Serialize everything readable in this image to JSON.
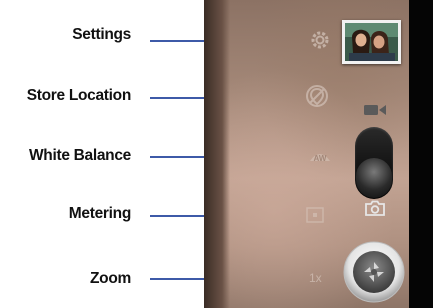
{
  "callouts": {
    "settings": "Settings",
    "store_location": "Store Location",
    "white_balance": "White Balance",
    "metering": "Metering",
    "zoom": "Zoom"
  },
  "viewfinder": {
    "zoom_level": "1x"
  },
  "colors": {
    "leader_line": "#3d5aa8",
    "label_text": "#111111"
  },
  "icons": [
    "settings-gear-icon",
    "location-icon",
    "white-balance-auto-icon",
    "metering-icon",
    "video-camera-icon",
    "still-camera-icon",
    "shutter-aperture-icon"
  ]
}
